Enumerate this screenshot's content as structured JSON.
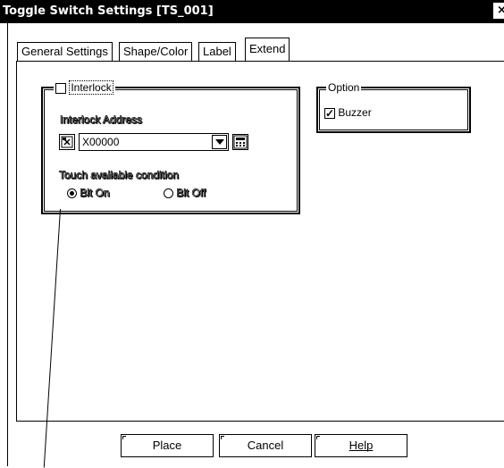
{
  "window": {
    "title": "Toggle Switch Settings [TS_001]",
    "close_label": "×"
  },
  "tabs": [
    {
      "label": "General Settings",
      "active": false
    },
    {
      "label": "Shape/Color",
      "active": false
    },
    {
      "label": "Label",
      "active": false
    },
    {
      "label": "Extend",
      "active": true
    }
  ],
  "interlock": {
    "checkbox_label": "Interlock",
    "checked": false,
    "address_label": "Interlock Address",
    "address_value": "X00000",
    "condition_label": "Touch available condition",
    "options": [
      {
        "label": "Bit On",
        "selected": true
      },
      {
        "label": "Bit Off",
        "selected": false
      }
    ]
  },
  "option": {
    "group_label": "Option",
    "buzzer_label": "Buzzer",
    "buzzer_checked": true,
    "check_glyph": "✓"
  },
  "buttons": {
    "place": "Place",
    "cancel": "Cancel",
    "help": "Help"
  },
  "icons": {
    "address_input_icon": "device-address-icon",
    "keypad_icon": "keypad-icon"
  }
}
